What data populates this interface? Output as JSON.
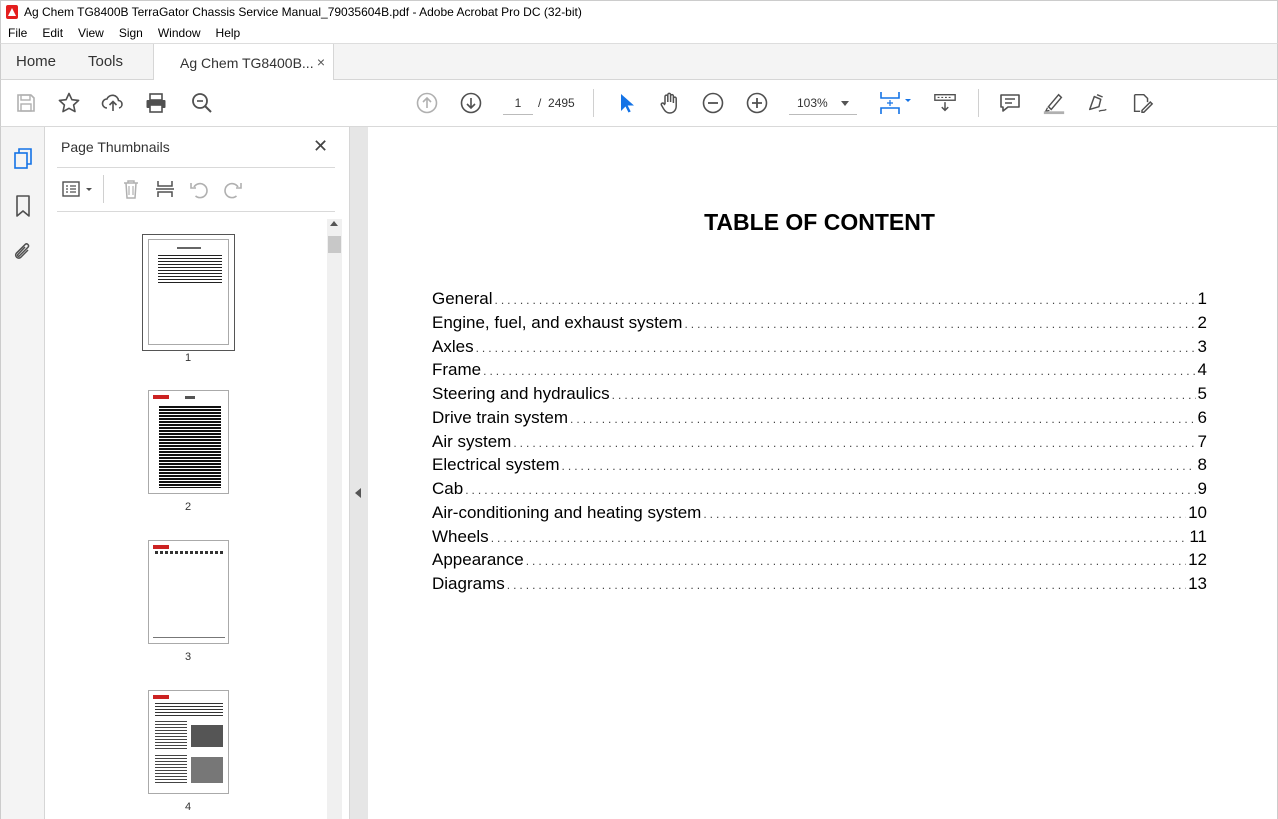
{
  "window": {
    "title": "Ag Chem TG8400B TerraGator Chassis Service Manual_79035604B.pdf - Adobe Acrobat Pro DC (32-bit)"
  },
  "menu": [
    "File",
    "Edit",
    "View",
    "Sign",
    "Window",
    "Help"
  ],
  "tabs": {
    "home": "Home",
    "tools": "Tools",
    "document": "Ag Chem TG8400B...",
    "close_glyph": "×"
  },
  "toolbar": {
    "current_page": "1",
    "page_separator": "/",
    "total_pages": "2495",
    "zoom": "103%",
    "icons": [
      "save-icon",
      "star-icon",
      "upload-icon",
      "print-icon",
      "search-zoom-icon",
      "prev-page-icon",
      "next-page-icon",
      "select-cursor-icon",
      "hand-icon",
      "zoom-out-icon",
      "zoom-in-icon",
      "fit-page-icon",
      "scroll-mode-icon",
      "comment-icon",
      "highlight-icon",
      "sign-icon",
      "edit-icon"
    ]
  },
  "thumbnails": {
    "panel_title": "Page Thumbnails",
    "close_glyph": "✕",
    "pages": [
      {
        "number": "1"
      },
      {
        "number": "2"
      },
      {
        "number": "3"
      },
      {
        "number": "4"
      }
    ]
  },
  "document": {
    "toc_title": "TABLE OF CONTENT",
    "entries": [
      {
        "label": "General",
        "page": "1"
      },
      {
        "label": "Engine, fuel, and exhaust system",
        "page": "2"
      },
      {
        "label": "Axles",
        "page": "3"
      },
      {
        "label": "Frame",
        "page": "4"
      },
      {
        "label": "Steering and hydraulics",
        "page": "5"
      },
      {
        "label": "Drive train system",
        "page": "6"
      },
      {
        "label": "Air system",
        "page": "7"
      },
      {
        "label": "Electrical system",
        "page": "8"
      },
      {
        "label": "Cab",
        "page": "9"
      },
      {
        "label": "Air-conditioning and heating system",
        "page": "10"
      },
      {
        "label": "Wheels",
        "page": "11"
      },
      {
        "label": "Appearance",
        "page": "12"
      },
      {
        "label": "Diagrams",
        "page": "13"
      }
    ]
  },
  "colors": {
    "accent_blue": "#1473e6",
    "icon_gray": "#505050",
    "disabled_gray": "#b0b0b0",
    "acrobat_red": "#e41e1e"
  }
}
